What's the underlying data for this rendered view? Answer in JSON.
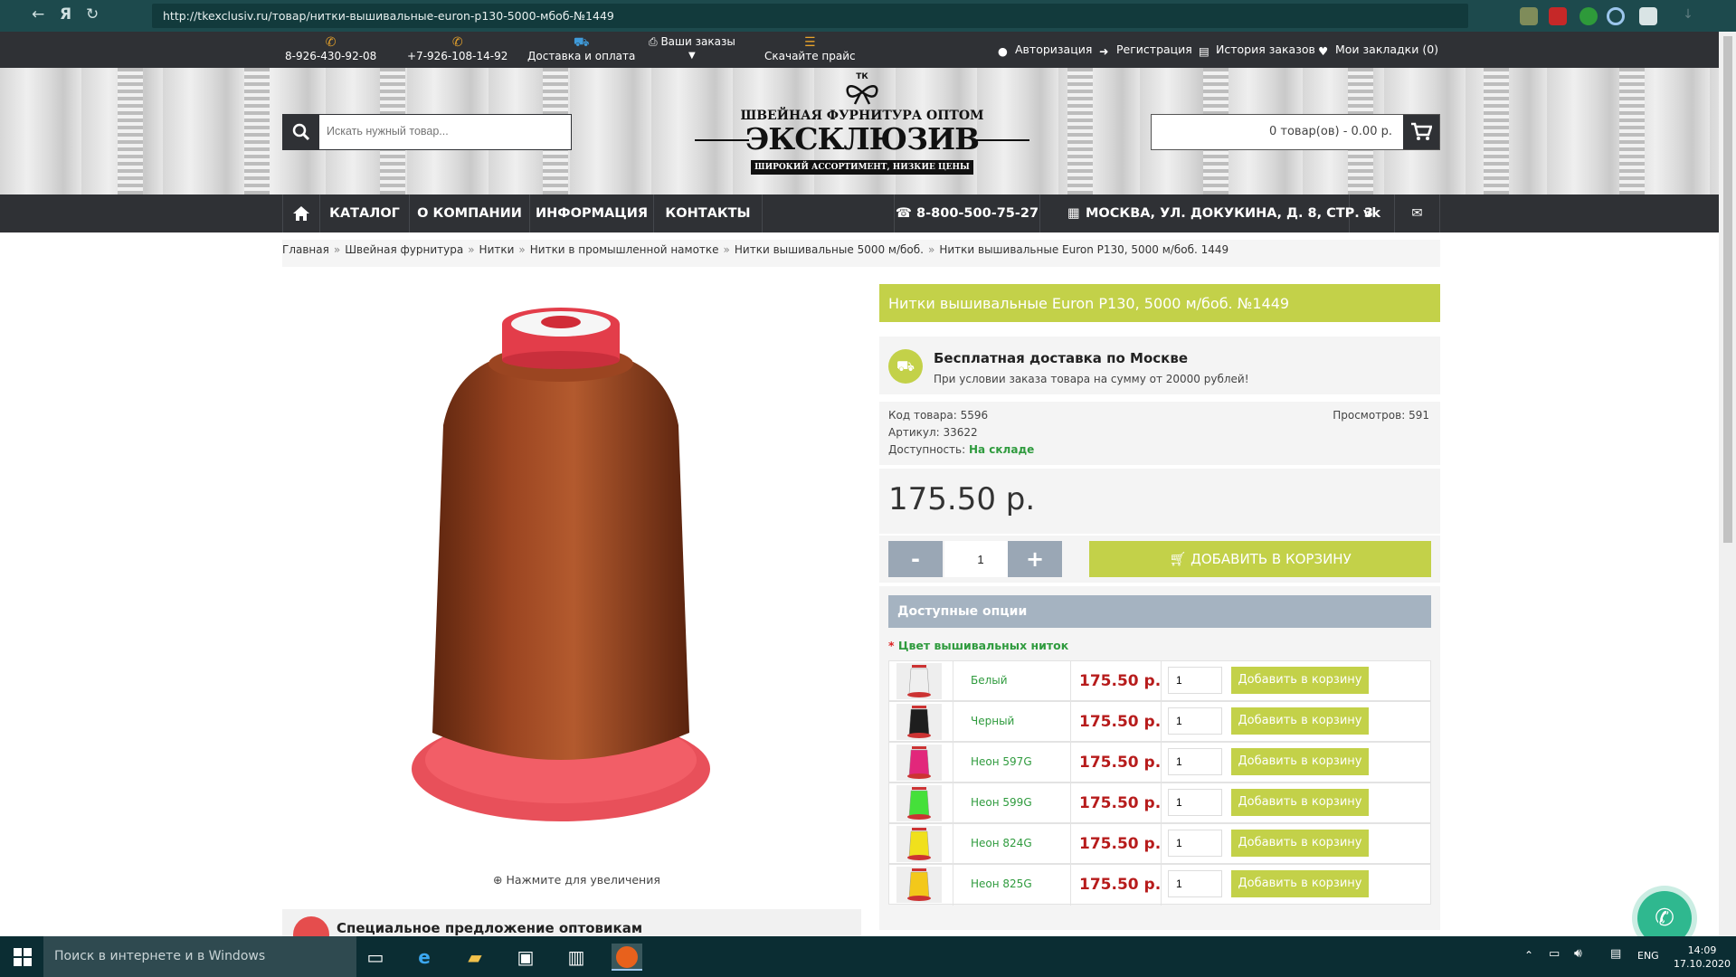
{
  "browser": {
    "url": "http://tkexclusiv.ru/товар/нитки-вышивальные-euron-p130-5000-мбоб-№1449"
  },
  "topbar": {
    "phone1": "8-926-430-92-08",
    "phone2": "+7-926-108-14-92",
    "delivery": "Доставка и оплата",
    "orders": "Ваши заказы",
    "pricelist": "Скачайте прайс",
    "login": "Авторизация",
    "register": "Регистрация",
    "history": "История заказов",
    "bookmarks": "Мои закладки (0)"
  },
  "header": {
    "search_placeholder": "Искать нужный товар...",
    "logo_tk": "ТК",
    "logo_line1": "ШВЕЙНАЯ ФУРНИТУРА ОПТОМ",
    "logo_main": "ЭКСКЛЮЗИВ",
    "logo_line2": "ШИРОКИЙ АССОРТИМЕНТ, НИЗКИЕ ЦЕНЫ",
    "cart_text": "0 товар(ов) - 0.00 р."
  },
  "menu": {
    "catalog": "КАТАЛОГ",
    "about": "О КОМПАНИИ",
    "info": "ИНФОРМАЦИЯ",
    "contacts": "КОНТАКТЫ",
    "phone": "8-800-500-75-27",
    "address": "МОСКВА, УЛ. ДОКУКИНА, Д. 8, СТР. 3"
  },
  "breadcrumb": [
    "Главная",
    "Швейная фурнитура",
    "Нитки",
    "Нитки в промышленной намотке",
    "Нитки вышивальные 5000 м/боб.",
    "Нитки вышивальные Euron P130, 5000 м/боб. 1449"
  ],
  "breadcrumb_sep": "»",
  "product": {
    "title": "Нитки вышивальные Euron P130, 5000 м/боб. №1449",
    "delivery_title": "Бесплатная доставка по Москве",
    "delivery_sub": "При условии заказа товара на сумму от 20000 рублей!",
    "code_label": "Код товара:",
    "code": "5596",
    "article_label": "Артикул:",
    "article": "33622",
    "avail_label": "Доступность:",
    "avail": "На складе",
    "views_label": "Просмотров:",
    "views": "591",
    "price": "175.50 р.",
    "qty": "1",
    "minus": "-",
    "plus": "+",
    "add_to_cart": "ДОБАВИТЬ В КОРЗИНУ",
    "zoom_hint": "Нажмите для увеличения",
    "special": "Специальное предложение оптовикам"
  },
  "options": {
    "header": "Доступные опции",
    "label_req": "*",
    "label": "Цвет вышивальных ниток",
    "add_label": "Добавить в корзину",
    "rows": [
      {
        "name": "Белый",
        "price": "175.50 р.",
        "qty": "1",
        "color": "#efefef"
      },
      {
        "name": "Черный",
        "price": "175.50 р.",
        "qty": "1",
        "color": "#1e1e1e"
      },
      {
        "name": "Неон 597G",
        "price": "175.50 р.",
        "qty": "1",
        "color": "#e2277b"
      },
      {
        "name": "Неон 599G",
        "price": "175.50 р.",
        "qty": "1",
        "color": "#45e03a"
      },
      {
        "name": "Неон 824G",
        "price": "175.50 р.",
        "qty": "1",
        "color": "#f0e01c"
      },
      {
        "name": "Неон 825G",
        "price": "175.50 р.",
        "qty": "1",
        "color": "#f3c81a"
      }
    ]
  },
  "taskbar": {
    "search": "Поиск в интернете и в Windows",
    "lang": "ENG",
    "time": "14:09",
    "date": "17.10.2020"
  },
  "colors": {
    "accent_green": "#c3d149",
    "dark": "#2f3135",
    "spool": "#8c3d1f"
  }
}
